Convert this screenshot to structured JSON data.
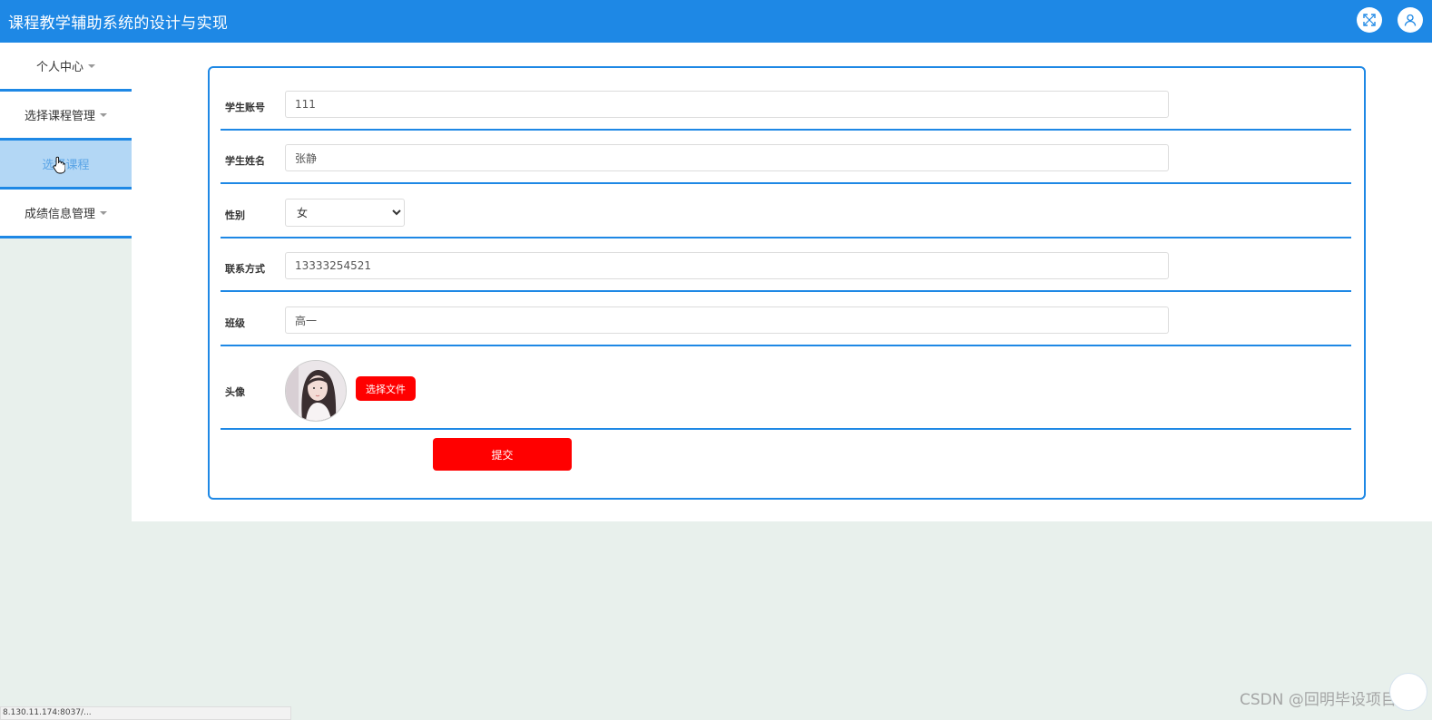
{
  "header": {
    "title": "课程教学辅助系统的设计与实现",
    "fullscreen_icon": "fullscreen-icon",
    "user_icon": "user-icon",
    "brand_color": "#1e88e5"
  },
  "sidebar": {
    "items": [
      {
        "label": "个人中心",
        "has_caret": true
      },
      {
        "label": "选择课程管理",
        "has_caret": true
      },
      {
        "label": "选择课程",
        "has_caret": false,
        "active": true
      },
      {
        "label": "成绩信息管理",
        "has_caret": true
      }
    ]
  },
  "form": {
    "account": {
      "label": "学生账号",
      "value": "111"
    },
    "name": {
      "label": "学生姓名",
      "value": "张静"
    },
    "gender": {
      "label": "性别",
      "selected": "女"
    },
    "phone": {
      "label": "联系方式",
      "value": "13333254521"
    },
    "class": {
      "label": "班级",
      "value": "高一"
    },
    "avatar": {
      "label": "头像",
      "choose_file": "选择文件"
    },
    "submit": "提交",
    "button_color": "#ff0000"
  },
  "watermark": "CSDN @回明毕设项目",
  "status_bar": "8.130.11.174:8037/..."
}
